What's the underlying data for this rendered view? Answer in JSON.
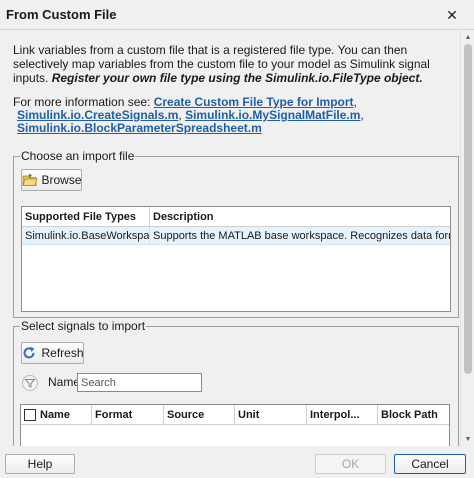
{
  "window": {
    "title": "From Custom File",
    "close_glyph": "✕"
  },
  "description": {
    "text": "Link variables from a custom file that is a registered file type. You can then selectively map variables from the custom file to your model as Simulink signal inputs. ",
    "emphasis": "Register your own file type using the Simulink.io.FileType object."
  },
  "more_info": {
    "prefix": "For more information see: ",
    "links": [
      {
        "label": "Create Custom File Type for Import",
        "suffix": ","
      },
      {
        "label": "Simulink.io.CreateSignals.m",
        "suffix": ", "
      },
      {
        "label": "Simulink.io.MySignalMatFile.m",
        "suffix": ","
      },
      {
        "label": "Simulink.io.BlockParameterSpreadsheet.m",
        "suffix": ""
      }
    ]
  },
  "import_group": {
    "legend": "Choose an import file",
    "browse_label": "Browse",
    "columns": [
      "Supported File Types",
      "Description"
    ],
    "rows": [
      {
        "type": "Simulink.io.BaseWorkspace",
        "description": "Supports the MATLAB base workspace. Recognizes data formatte..."
      }
    ]
  },
  "signals_group": {
    "legend": "Select signals to import",
    "refresh_label": "Refresh",
    "name_label": "Name",
    "search_placeholder": "Search",
    "columns": [
      "Name",
      "Format",
      "Source",
      "Unit",
      "Interpol...",
      "Block Path"
    ]
  },
  "footer": {
    "help_label": "Help",
    "ok_label": "OK",
    "cancel_label": "Cancel"
  },
  "colors": {
    "link": "#1f5fa8",
    "selected_row": "#e6f2fc",
    "cancel_border": "#1f5fa8"
  }
}
